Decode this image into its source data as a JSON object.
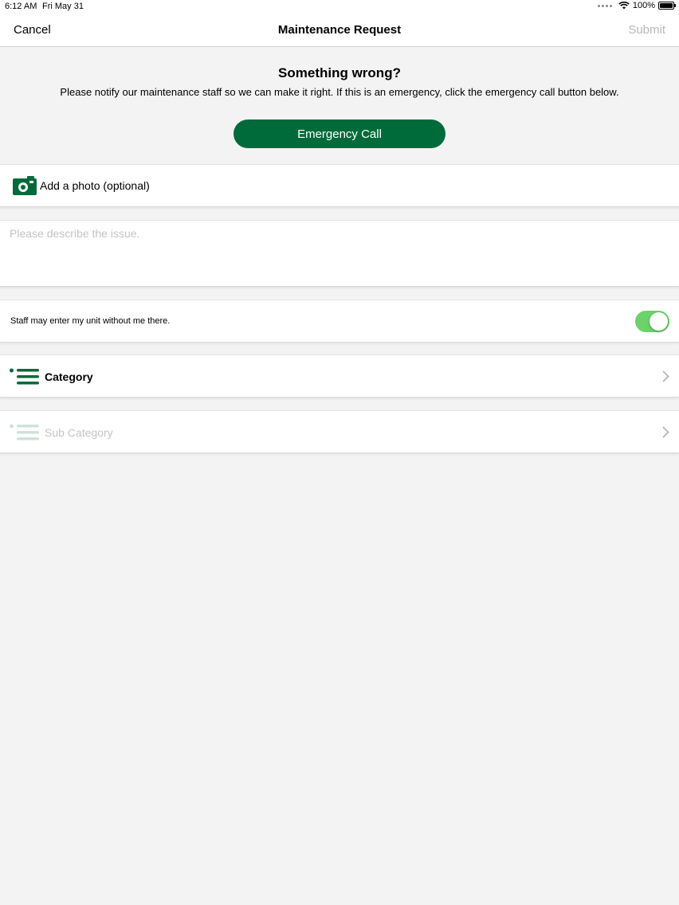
{
  "status_bar": {
    "time": "6:12 AM",
    "date": "Fri May 31",
    "battery": "100%"
  },
  "nav": {
    "cancel": "Cancel",
    "title": "Maintenance Request",
    "submit": "Submit"
  },
  "intro": {
    "heading": "Something wrong?",
    "message": "Please notify our maintenance staff so we can make it right. If this is an emergency, click the emergency call button below.",
    "emergency_button": "Emergency Call"
  },
  "photo": {
    "label": "Add a photo (optional)",
    "icon": "camera-icon"
  },
  "description": {
    "placeholder": "Please describe the issue.",
    "value": ""
  },
  "entry_permission": {
    "label": "Staff may enter my unit without me there.",
    "enabled": true
  },
  "category": {
    "label": "Category",
    "icon": "list-icon"
  },
  "sub_category": {
    "label": "Sub Category",
    "icon": "list-icon",
    "disabled": true
  },
  "colors": {
    "brand": "#006b3a",
    "toggle_on": "#6cd26a",
    "disabled_text": "#c4c4c4",
    "background": "#f3f3f3"
  }
}
